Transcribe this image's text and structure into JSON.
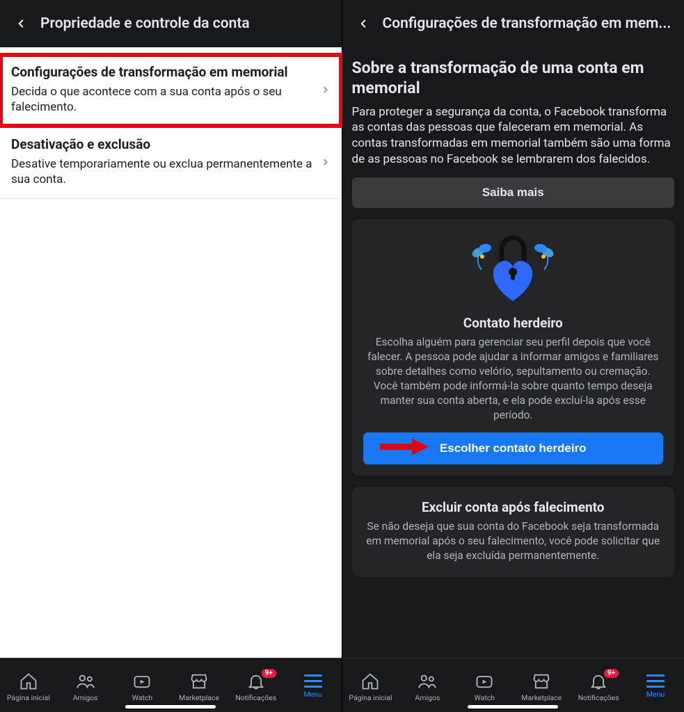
{
  "left": {
    "header_title": "Propriedade e controle da conta",
    "items": [
      {
        "title": "Configurações de transformação em memorial",
        "desc": "Decida o que acontece com a sua conta após o seu falecimento."
      },
      {
        "title": "Desativação e exclusão",
        "desc": "Desative temporariamente ou exclua permanentemente a sua conta."
      }
    ]
  },
  "right": {
    "header_title": "Configurações de transformação em mem...",
    "section_title": "Sobre a transformação de uma conta em memorial",
    "section_desc": "Para proteger a segurança da conta, o Facebook transforma as contas das pessoas que faleceram em memorial. As contas transformadas em memorial também são uma forma de as pessoas no Facebook se lembrarem dos falecidos.",
    "learn_more": "Saiba mais",
    "legacy": {
      "title": "Contato herdeiro",
      "desc": "Escolha alguém para gerenciar seu perfil depois que você falecer. A pessoa pode ajudar a informar amigos e familiares sobre detalhes como velório, sepultamento ou cremação. Você também pode informá-la sobre quanto tempo deseja manter sua conta aberta, e ela pode excluí-la após esse período.",
      "button": "Escolher contato herdeiro"
    },
    "delete": {
      "title": "Excluir conta após falecimento",
      "desc": "Se não deseja que sua conta do Facebook seja transformada em memorial após o seu falecimento, você pode solicitar que ela seja excluída permanentemente."
    }
  },
  "tabbar": {
    "home": "Página inicial",
    "friends": "Amigos",
    "watch": "Watch",
    "marketplace": "Marketplace",
    "notifications": "Notificações",
    "menu": "Menu",
    "badge": "9+"
  }
}
